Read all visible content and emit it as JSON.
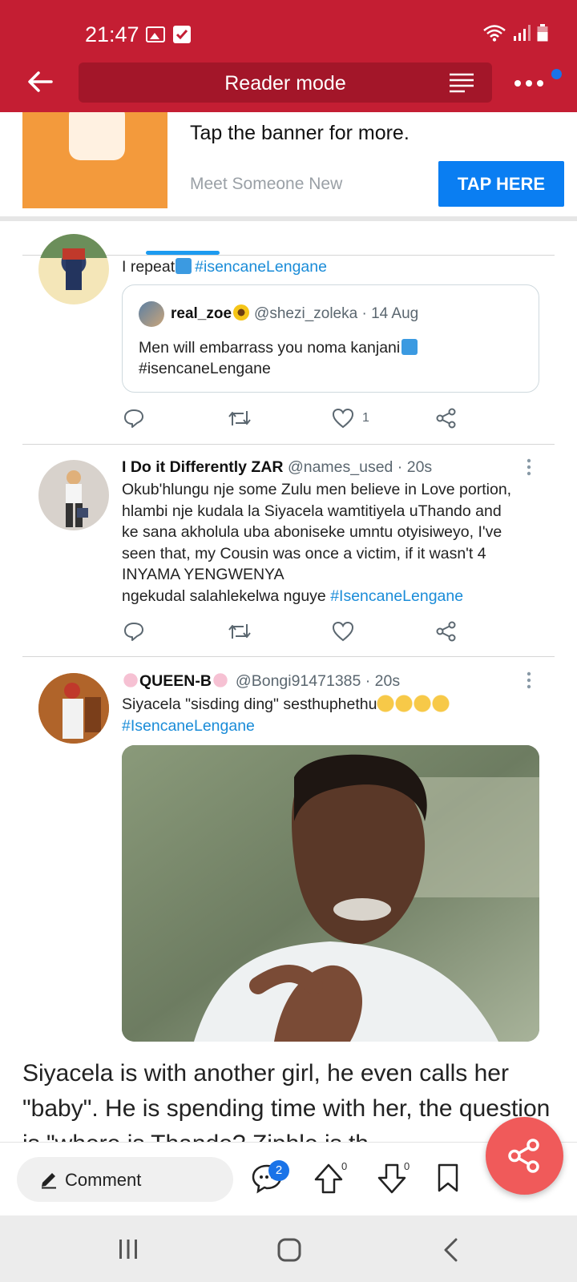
{
  "status_bar": {
    "time": "21:47"
  },
  "app_bar": {
    "title": "Reader mode"
  },
  "ad": {
    "headline": "Tap the banner for more.",
    "subtitle": "Meet Someone New",
    "cta": "TAP HERE"
  },
  "tweet1": {
    "text_prefix": "I repeat",
    "text_hashtag": "#isencaneLengane",
    "quote": {
      "name": "real_zoe",
      "handle_time": "@shezi_zoleka · 14 Aug",
      "line1": "Men will embarrass you noma kanjani",
      "line2": "#isencaneLengane"
    },
    "like_count": "1"
  },
  "tweet2": {
    "name": "I Do it Differently ZAR",
    "handle_time": "@names_used · 20s",
    "line1": "Okub'hlungu nje some Zulu men believe in Love portion,",
    "line2": "hlambi nje kudala la Siyacela wamtitiyela uThando and",
    "line3": "ke sana akholula uba aboniseke umntu otyisiweyo, I've",
    "line4": "seen that, my Cousin was once a victim, if it wasn't 4",
    "line5": "INYAMA YENGWENYA",
    "line6": "ngekudal salahlekelwa nguye ",
    "hashtag": "#IsencaneLengane"
  },
  "tweet3": {
    "name": "QUEEN-B",
    "handle_time": "@Bongi91471385 · 20s",
    "text": "Siyacela \"sisding ding\" sesthuphethu",
    "hashtag": "#IsencaneLengane"
  },
  "article": {
    "text": "Siyacela is with another girl, he even calls her \"baby\". He is spending time with her, the question is \"where is Thando? Ziphle is th"
  },
  "bottom_bar": {
    "comment_label": "Comment",
    "comment_count": "2",
    "upvote_count": "0",
    "downvote_count": "0"
  }
}
